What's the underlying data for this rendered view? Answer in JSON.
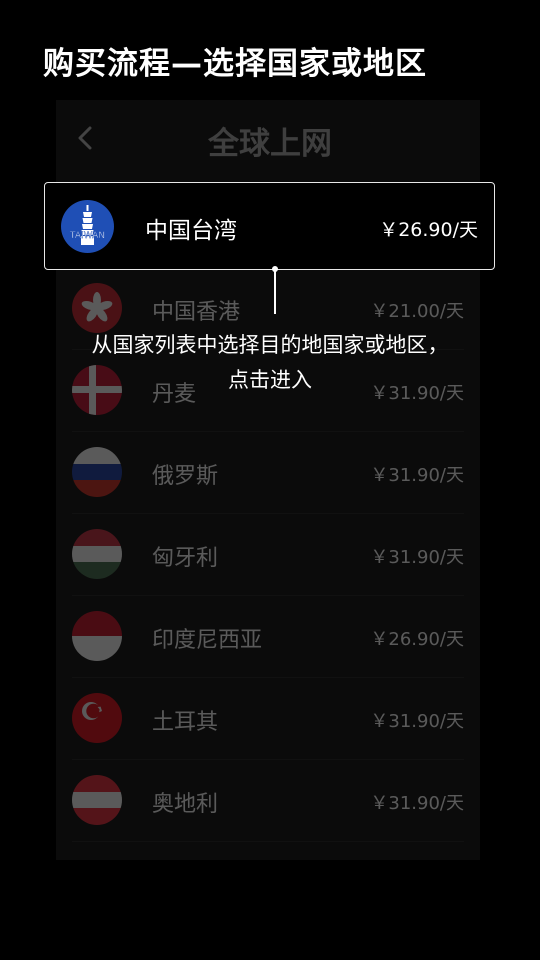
{
  "guide": {
    "title": "购买流程—选择国家或地区",
    "tooltip_line1": "从国家列表中选择目的地国家或地区，",
    "tooltip_line2": "点击进入"
  },
  "header": {
    "back_icon": "chevron-left-icon",
    "title": "全球上网"
  },
  "selected": {
    "name": "中国台湾",
    "price": "￥26.90/天",
    "flag_icon": "taiwan-landmark-icon",
    "flag_text": "TAIWAN"
  },
  "countries": [
    {
      "name": "中国香港",
      "price": "￥21.00/天",
      "flag_icon": "hong-kong-flag-icon"
    },
    {
      "name": "丹麦",
      "price": "￥31.90/天",
      "flag_icon": "denmark-flag-icon"
    },
    {
      "name": "俄罗斯",
      "price": "￥31.90/天",
      "flag_icon": "russia-flag-icon"
    },
    {
      "name": "匈牙利",
      "price": "￥31.90/天",
      "flag_icon": "hungary-flag-icon"
    },
    {
      "name": "印度尼西亚",
      "price": "￥26.90/天",
      "flag_icon": "indonesia-flag-icon"
    },
    {
      "name": "土耳其",
      "price": "￥31.90/天",
      "flag_icon": "turkey-flag-icon"
    },
    {
      "name": "奥地利",
      "price": "￥31.90/天",
      "flag_icon": "austria-flag-icon"
    }
  ],
  "colors": {
    "background": "#000000",
    "highlight_border": "#e8e8e8",
    "dim_text": "#3f3f3f"
  }
}
